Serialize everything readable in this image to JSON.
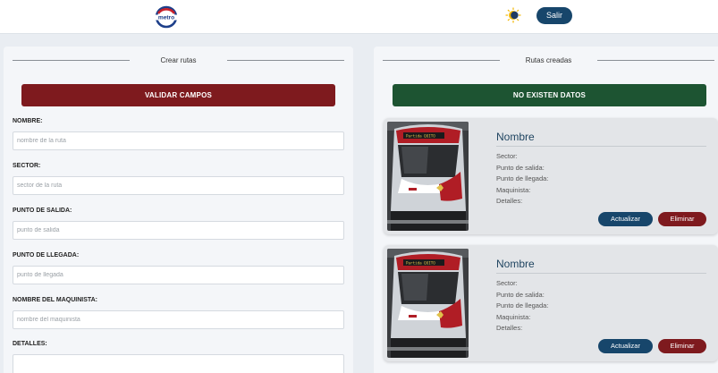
{
  "header": {
    "logo_text": "metro",
    "logout_label": "Salir",
    "theme_icon": "sun-moon-icon"
  },
  "create": {
    "section_title": "Crear rutas",
    "validate_label": "VALIDAR CAMPOS",
    "fields": [
      {
        "label": "NOMBRE:",
        "placeholder": "nombre de la ruta"
      },
      {
        "label": "SECTOR:",
        "placeholder": "sector de la ruta"
      },
      {
        "label": "PUNTO DE SALIDA:",
        "placeholder": "punto de salida"
      },
      {
        "label": "PUNTO DE LLEGADA:",
        "placeholder": "punto de llegada"
      },
      {
        "label": "NOMBRE DEL MAQUINISTA:",
        "placeholder": "nombre del maquinista"
      },
      {
        "label": "DETALLES:",
        "placeholder": ""
      }
    ]
  },
  "routes": {
    "section_title": "Rutas creadas",
    "empty_label": "NO EXISTEN DATOS",
    "cards": [
      {
        "title": "Nombre",
        "sector": "Sector:",
        "departure": "Punto de salida:",
        "arrival": "Punto de llegada:",
        "driver": "Maquinista:",
        "details": "Detalles:",
        "update_label": "Actualizar",
        "delete_label": "Eliminar",
        "destination_sign": "Partida QUITO"
      },
      {
        "title": "Nombre",
        "sector": "Sector:",
        "departure": "Punto de salida:",
        "arrival": "Punto de llegada:",
        "driver": "Maquinista:",
        "details": "Detalles:",
        "update_label": "Actualizar",
        "delete_label": "Eliminar",
        "destination_sign": "Partida QUITO"
      }
    ]
  },
  "colors": {
    "brand_blue": "#17466b",
    "danger_red": "#7e1a1e",
    "success_green": "#1d5432"
  }
}
